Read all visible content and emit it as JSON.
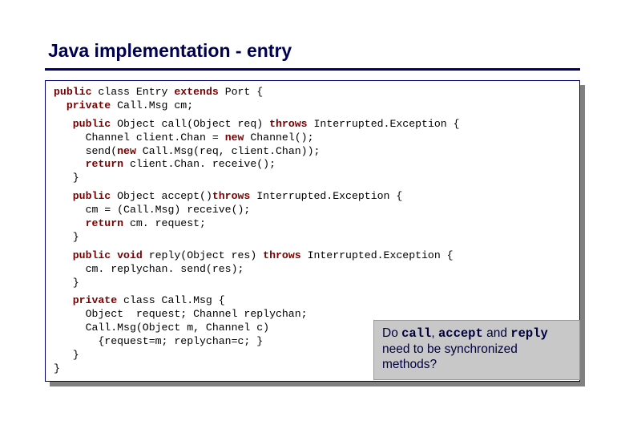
{
  "title": "Java implementation - entry",
  "code": {
    "l1a": "public",
    "l1b": " class Entry ",
    "l1c": "extends",
    "l1d": " Port {",
    "l2a": "  private",
    "l2b": " Call.Msg cm;",
    "l3a": "   public",
    "l3b": " Object call(Object req) ",
    "l3c": "throws",
    "l3d": " Interrupted.Exception {",
    "l4": "     Channel client.Chan = ",
    "l4b": "new",
    "l4c": " Channel();",
    "l5": "     send(",
    "l5b": "new",
    "l5c": " Call.Msg(req, client.Chan));",
    "l6a": "     return",
    "l6b": " client.Chan. receive();",
    "l7": "   }",
    "l8a": "   public",
    "l8b": " Object accept()",
    "l8c": "throws",
    "l8d": " Interrupted.Exception {",
    "l9": "     cm = (Call.Msg) receive();",
    "l10a": "     return",
    "l10b": " cm. request;",
    "l11": "   }",
    "l12a": "   public void",
    "l12b": " reply(Object res) ",
    "l12c": "throws",
    "l12d": " Interrupted.Exception {",
    "l13": "     cm. replychan. send(res);",
    "l14": "   }",
    "l15a": "   private",
    "l15b": " class Call.Msg {",
    "l16": "     Object  request; Channel replychan;",
    "l17": "     Call.Msg(Object m, Channel c)",
    "l18": "       {request=m; replychan=c; }",
    "l19": "   }",
    "l20": "}"
  },
  "callout": {
    "t1": "Do ",
    "m1": "call",
    "t2": ", ",
    "m2": "accept",
    "t3": " and ",
    "m3": "reply",
    "t4": " need to be synchronized methods?"
  }
}
